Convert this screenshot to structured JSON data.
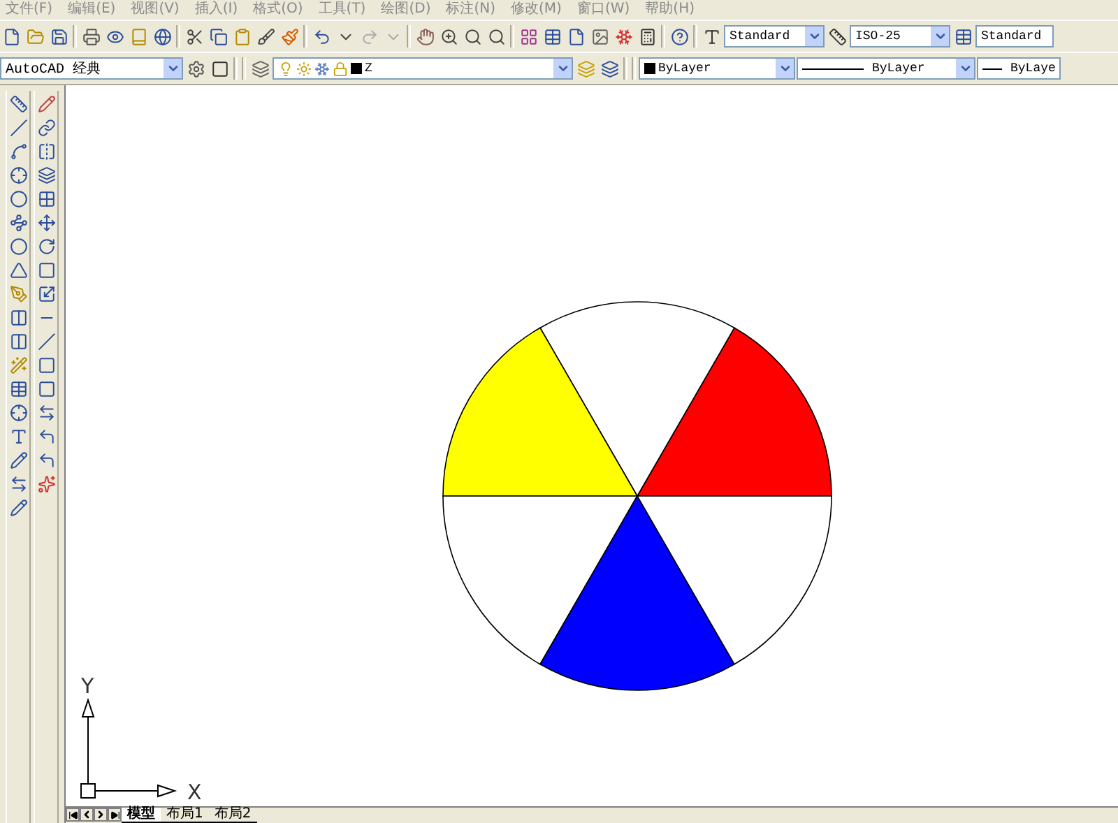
{
  "menu_bar": [
    {
      "label": "文件(F)"
    },
    {
      "label": "编辑(E)"
    },
    {
      "label": "视图(V)"
    },
    {
      "label": "插入(I)"
    },
    {
      "label": "格式(O)"
    },
    {
      "label": "工具(T)"
    },
    {
      "label": "绘图(D)"
    },
    {
      "label": "标注(N)"
    },
    {
      "label": "修改(M)"
    },
    {
      "label": "窗口(W)"
    },
    {
      "label": "帮助(H)"
    }
  ],
  "styles_toolbar": {
    "text_style": "Standard",
    "dimension_style": "ISO-25",
    "table_style": "Standard"
  },
  "workspace_combo": {
    "value": "AutoCAD 经典"
  },
  "layer_combo": {
    "value": "Z"
  },
  "properties_toolbar": {
    "color_control": "ByLayer",
    "linetype": "ByLayer",
    "lineweight": "ByLaye"
  },
  "drawing": {
    "sectors": [
      {
        "color": "#ff0000"
      },
      {
        "color": "#ffffff"
      },
      {
        "color": "#ffff00"
      },
      {
        "color": "#ffffff"
      },
      {
        "color": "#0000ff"
      },
      {
        "color": "#ffffff"
      }
    ]
  },
  "ucs": {
    "x_label": "X",
    "y_label": "Y"
  },
  "layout_tabs": [
    {
      "label": "模型",
      "selected": true
    },
    {
      "label": "布局1",
      "selected": false
    },
    {
      "label": "布局2",
      "selected": false
    }
  ]
}
